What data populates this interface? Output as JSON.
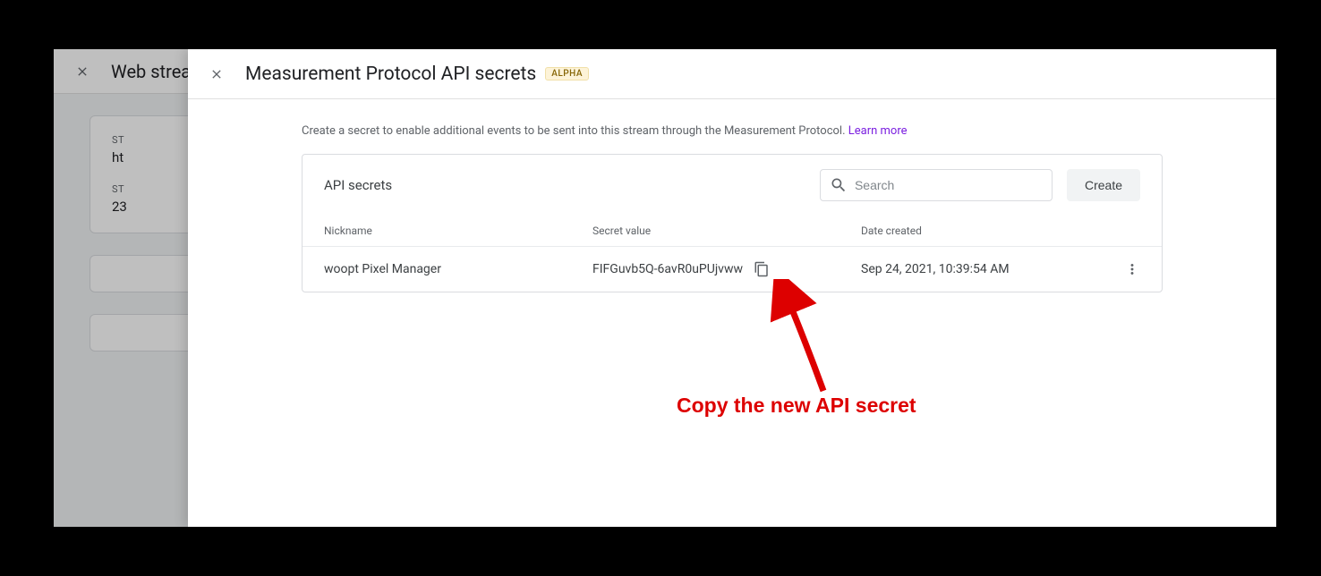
{
  "background": {
    "title": "Web strea",
    "label1": "ST",
    "value1": "ht",
    "label2": "ST",
    "value2": "23"
  },
  "modal": {
    "title": "Measurement Protocol API secrets",
    "badge": "ALPHA",
    "help_text": "Create a secret to enable additional events to be sent into this stream through the Measurement Protocol. ",
    "learn_more": "Learn more",
    "card_title": "API secrets",
    "search_placeholder": "Search",
    "create_label": "Create",
    "columns": {
      "nickname": "Nickname",
      "secret": "Secret value",
      "date": "Date created"
    },
    "rows": [
      {
        "nickname": "woopt Pixel Manager",
        "secret": "FIFGuvb5Q-6avR0uPUjvww",
        "date": "Sep 24, 2021, 10:39:54 AM"
      }
    ]
  },
  "annotation": {
    "text": "Copy the new API secret"
  }
}
